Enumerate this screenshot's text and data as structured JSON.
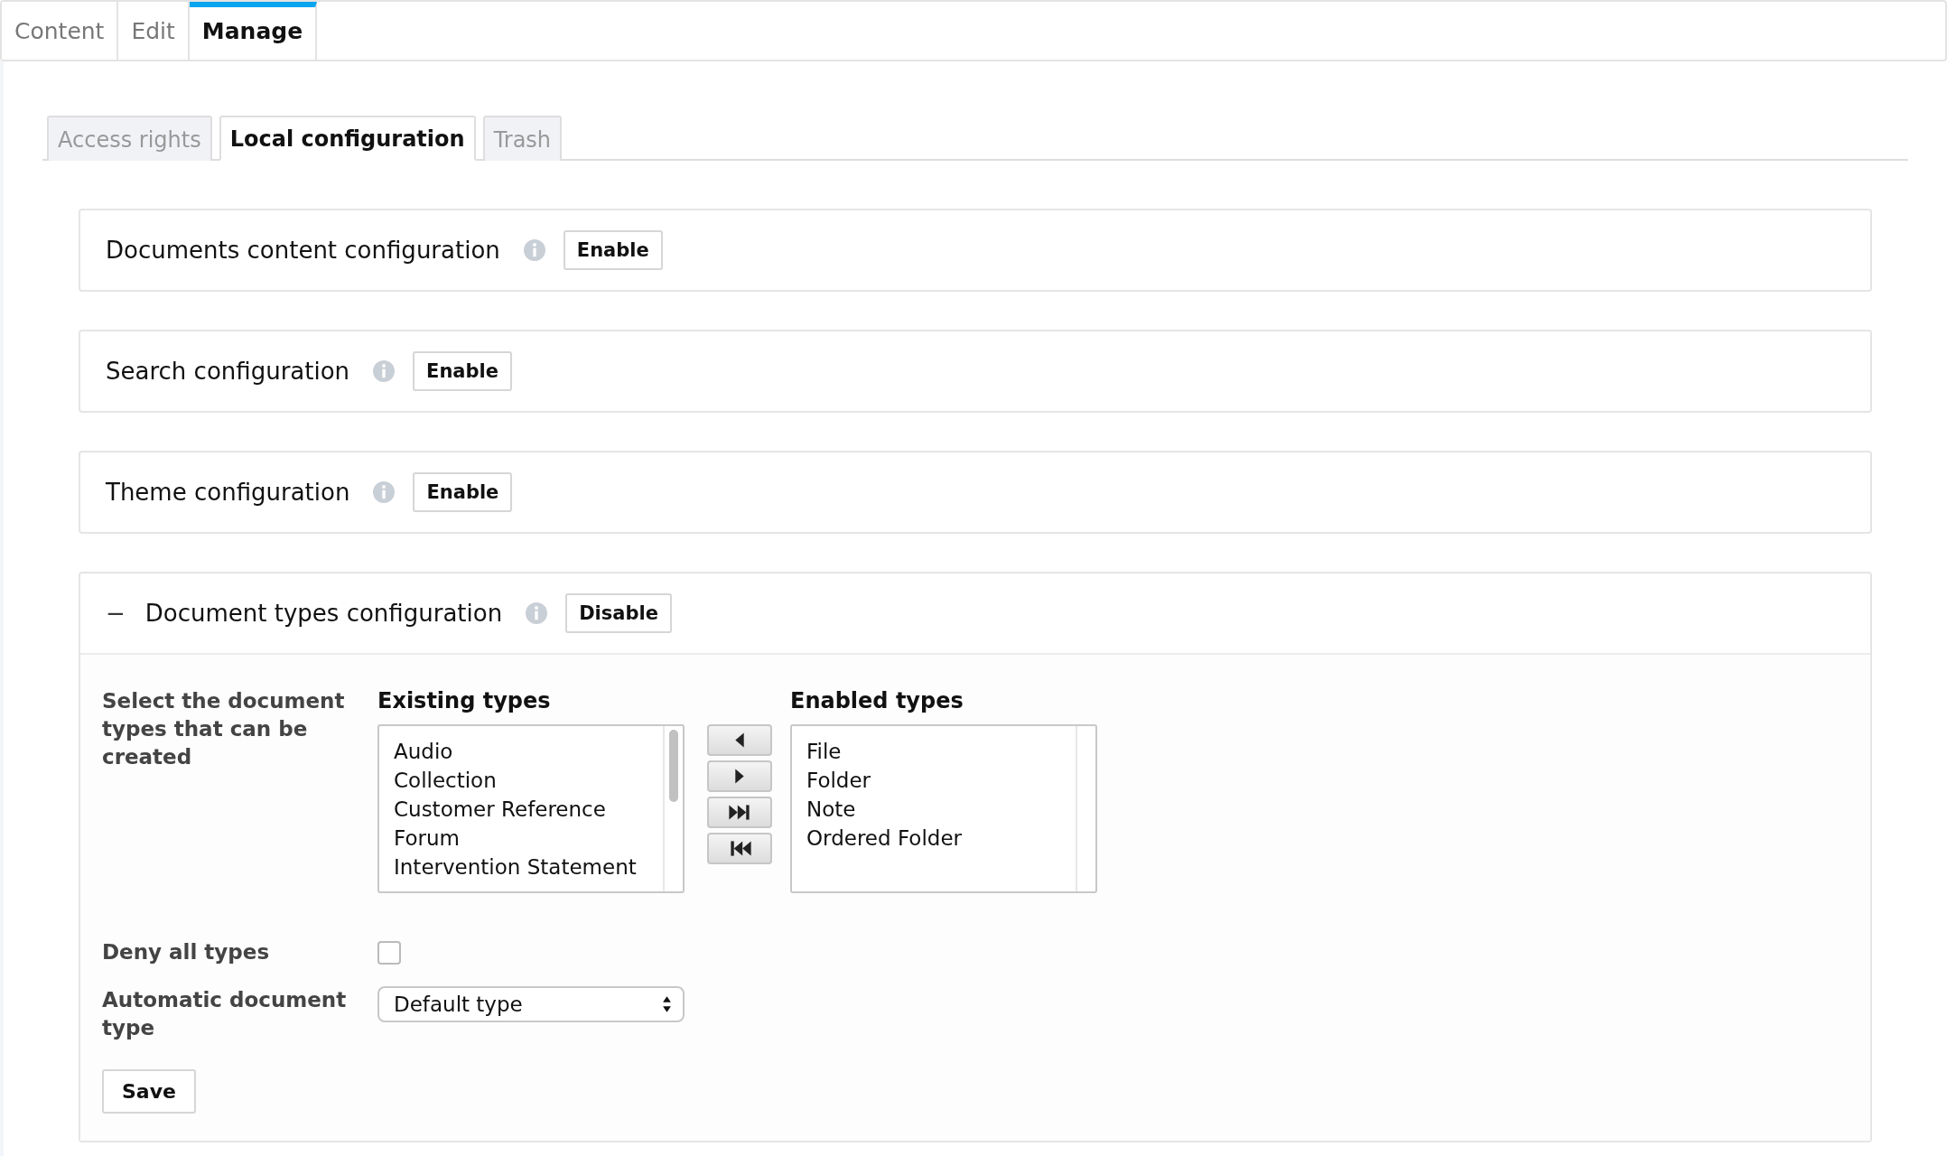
{
  "top_tabs": [
    {
      "label": "Content",
      "selected": false
    },
    {
      "label": "Edit",
      "selected": false
    },
    {
      "label": "Manage",
      "selected": true
    }
  ],
  "sub_tabs": [
    {
      "label": "Access rights",
      "selected": false
    },
    {
      "label": "Local configuration",
      "selected": true
    },
    {
      "label": "Trash",
      "selected": false
    }
  ],
  "sections": [
    {
      "title": "Documents content configuration",
      "button": "Enable",
      "expanded": false
    },
    {
      "title": "Search configuration",
      "button": "Enable",
      "expanded": false
    },
    {
      "title": "Theme configuration",
      "button": "Enable",
      "expanded": false
    },
    {
      "title": "Document types configuration",
      "button": "Disable",
      "expanded": true,
      "toggle": "−"
    }
  ],
  "document_types": {
    "label": "Select the document types that can be created",
    "existing": {
      "heading": "Existing types",
      "items": [
        "Audio",
        "Collection",
        "Customer Reference",
        "Forum",
        "Intervention Statement"
      ]
    },
    "move_buttons": [
      {
        "kind": "left"
      },
      {
        "kind": "right"
      },
      {
        "kind": "all-right"
      },
      {
        "kind": "all-left"
      }
    ],
    "enabled": {
      "heading": "Enabled types",
      "items": [
        "File",
        "Folder",
        "Note",
        "Ordered Folder"
      ]
    },
    "deny_all": {
      "label": "Deny all types",
      "checked": false
    },
    "automatic": {
      "label": "Automatic document type",
      "value": "Default type"
    },
    "save": "Save"
  }
}
